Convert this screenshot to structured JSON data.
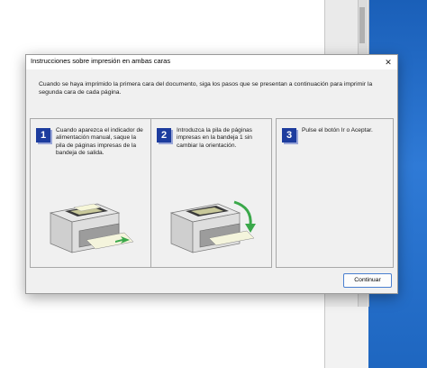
{
  "dialog": {
    "title": "Instrucciones sobre impresión en ambas caras",
    "close_glyph": "✕",
    "intro": "Cuando se haya imprimido la primera cara del documento, siga los pasos que se presentan a continuación para imprimir la segunda cara de cada página.",
    "steps": [
      {
        "number": "1",
        "text": "Cuando aparezca el indicador de alimentación manual, saque la pila de páginas impresas de la bandeja de salida."
      },
      {
        "number": "2",
        "text": "Introduzca la pila de páginas impresas en la bandeja 1 sin cambiar la orientación."
      },
      {
        "number": "3",
        "text": "Pulse el botón Ir o Aceptar."
      }
    ],
    "continue_label": "Continuar"
  },
  "colors": {
    "step_badge": "#1d3c9e",
    "arrow_green": "#3aa84a",
    "desktop_blue": "#1e66c0"
  }
}
